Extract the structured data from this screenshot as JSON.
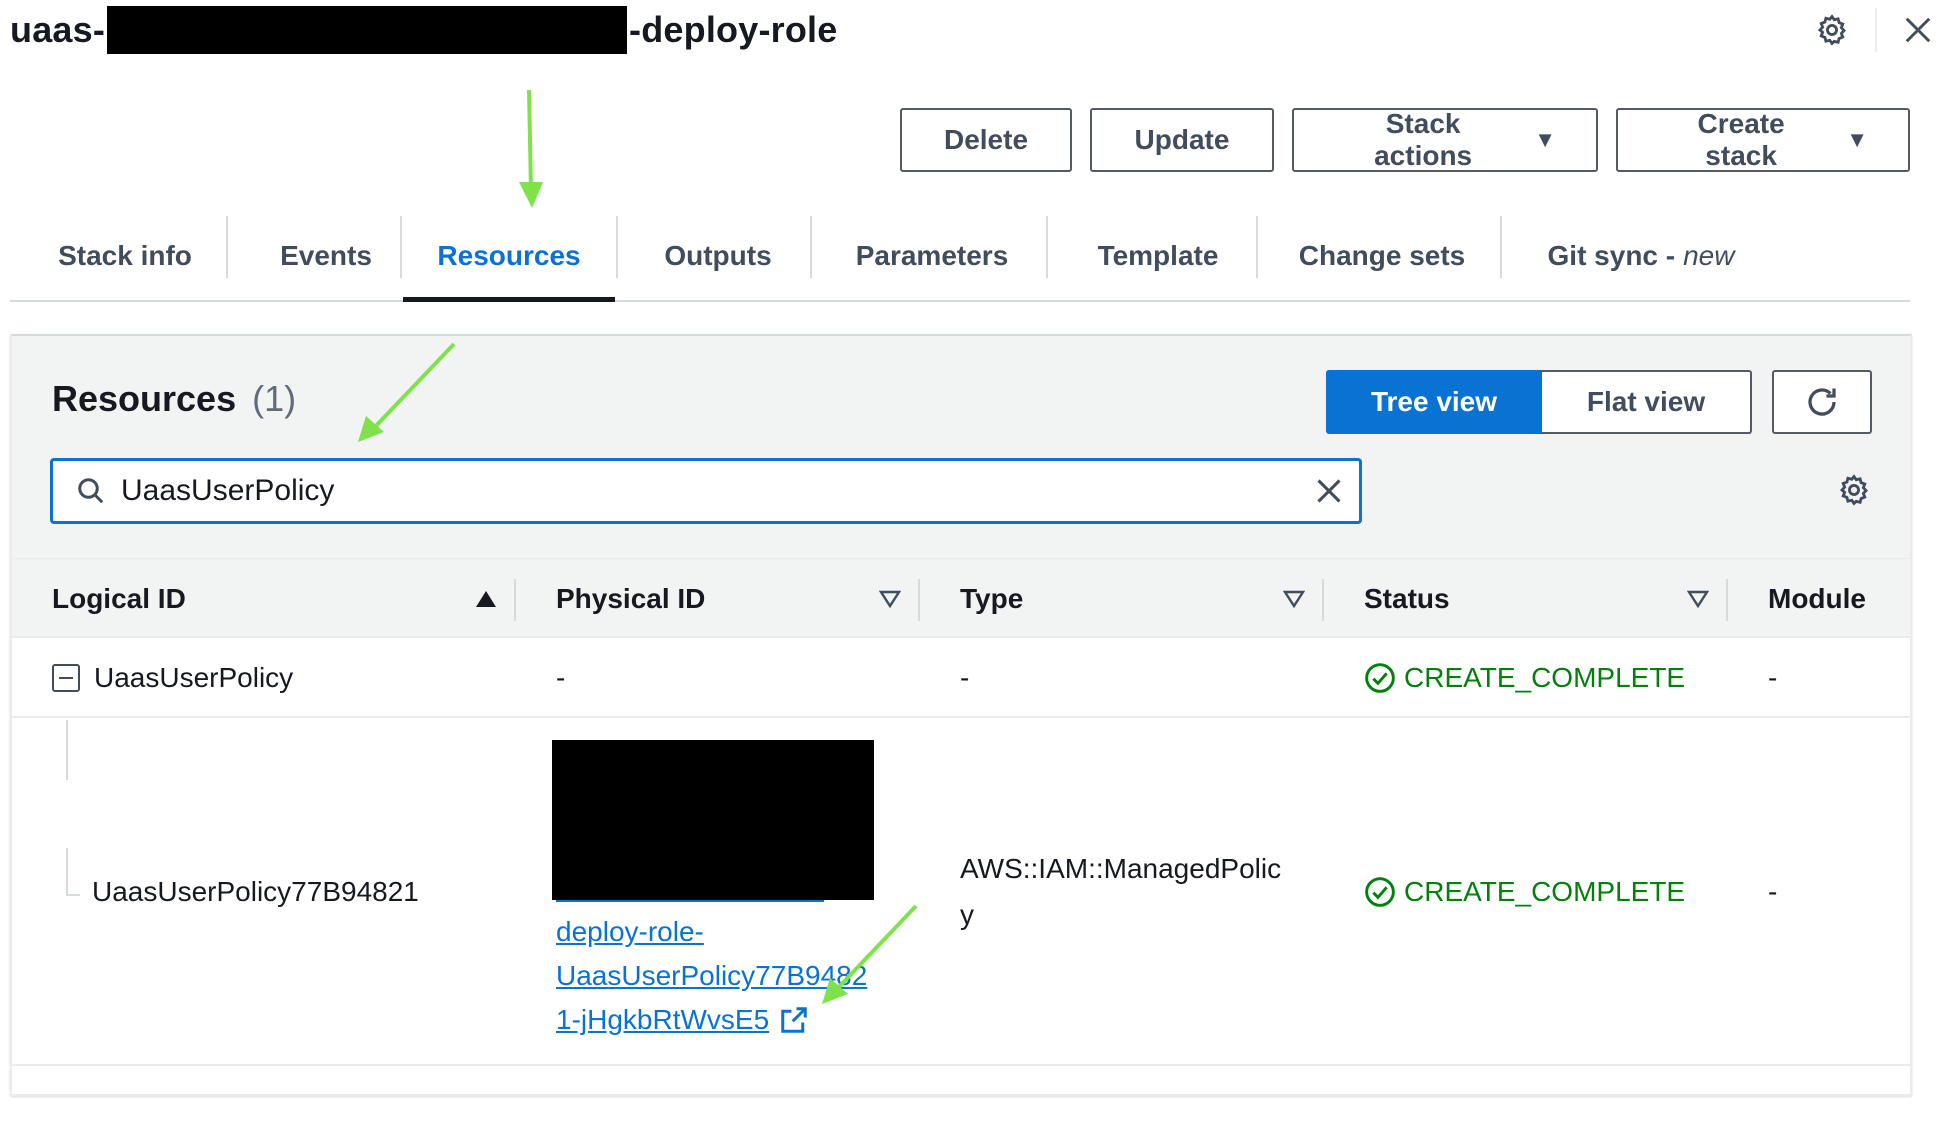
{
  "header": {
    "title_prefix": "uaas-",
    "title_suffix": "-deploy-role"
  },
  "actions": {
    "delete": "Delete",
    "update": "Update",
    "stack_actions": "Stack actions",
    "create_stack": "Create stack"
  },
  "tabs": [
    {
      "label": "Stack info"
    },
    {
      "label": "Events"
    },
    {
      "label": "Resources"
    },
    {
      "label": "Outputs"
    },
    {
      "label": "Parameters"
    },
    {
      "label": "Template"
    },
    {
      "label": "Change sets"
    },
    {
      "label": "Git sync -",
      "badge": "new"
    }
  ],
  "resources": {
    "title": "Resources",
    "count": "(1)",
    "tree_view": "Tree view",
    "flat_view": "Flat view",
    "search_value": "UaasUserPolicy",
    "columns": [
      "Logical ID",
      "Physical ID",
      "Type",
      "Status",
      "Module"
    ],
    "rows": [
      {
        "logical_id": "UaasUserPolicy",
        "physical_id": "-",
        "type": "-",
        "status": "CREATE_COMPLETE",
        "module": "-"
      },
      {
        "logical_id": "UaasUserPolicy77B94821",
        "physical_id_lines": [
          "deploy-role-",
          "UaasUserPolicy77B9482",
          "1-jHgkbRtWvsE5"
        ],
        "type_lines": [
          "AWS::IAM::ManagedPolic",
          "y"
        ],
        "status": "CREATE_COMPLETE",
        "module": "-"
      }
    ]
  },
  "colors": {
    "accent": "#0972d3",
    "success": "#037f0c",
    "annotation_arrow": "#7ee34b"
  }
}
